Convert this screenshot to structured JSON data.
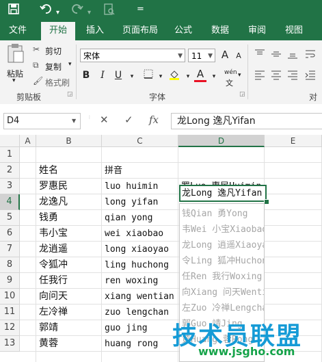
{
  "quick_access": {
    "save_icon": "save-icon",
    "undo_icon": "undo-icon",
    "redo_icon": "redo-icon",
    "more": "="
  },
  "tabs": [
    {
      "label": "文件",
      "active": false
    },
    {
      "label": "开始",
      "active": true
    },
    {
      "label": "插入",
      "active": false
    },
    {
      "label": "页面布局",
      "active": false
    },
    {
      "label": "公式",
      "active": false
    },
    {
      "label": "数据",
      "active": false
    },
    {
      "label": "审阅",
      "active": false
    },
    {
      "label": "视图",
      "active": false
    }
  ],
  "ribbon": {
    "clipboard": {
      "paste": "粘贴",
      "cut": "剪切",
      "copy": "复制",
      "format_painter": "格式刷",
      "group_label": "剪贴板"
    },
    "font": {
      "name": "宋体",
      "size": "11",
      "grow": "A",
      "shrink": "A",
      "bold": "B",
      "italic": "I",
      "underline": "U",
      "font_color": "A",
      "wen": "wén",
      "group_label": "字体"
    },
    "alignment": {
      "group_label": "对齐"
    },
    "colors": {
      "accent": "#217346",
      "font_color_bar": "#e81123"
    }
  },
  "formula_bar": {
    "name_box": "D4",
    "cancel": "✕",
    "enter": "✓",
    "fx": "fx",
    "formula": "龙Long 逸凡Yifan"
  },
  "columns": [
    "A",
    "B",
    "C",
    "D",
    "E"
  ],
  "rows": [
    "1",
    "2",
    "3",
    "4",
    "5",
    "6",
    "7",
    "8",
    "9",
    "10",
    "11",
    "12",
    "13"
  ],
  "cells": {
    "B": [
      "",
      "姓名",
      "罗惠民",
      "龙逸凡",
      "钱勇",
      "韦小宝",
      "龙逍遥",
      "令狐冲",
      "任我行",
      "向问天",
      "左冷禅",
      "郭靖",
      "黄蓉"
    ],
    "C": [
      "",
      "拼音",
      "luo huimin",
      "long yifan",
      "qian yong",
      "wei xiaobao",
      "long xiaoyao",
      "ling huchong",
      "ren woxing",
      "xiang wentian",
      "zuo lengchan",
      "guo jing",
      "huang rong"
    ],
    "D3": "罗Luo 惠民Huimin",
    "D4": "龙Long 逸凡Yifan"
  },
  "flash_fill_preview": [
    "钱Qian 勇Yong",
    "韦Wei 小宝Xiaobao",
    "龙Long 逍遥Xiaoyao",
    "令Ling 狐冲Huchong",
    "任Ren 我行Woxing",
    "向Xiang 问天Wentian",
    "左Zuo 冷禅Lengchan",
    "郭Guo 靖Jing",
    "黄Huang 蓉Rong"
  ],
  "watermark": {
    "text": "技术员联盟",
    "url": "www.jsgho.com"
  }
}
